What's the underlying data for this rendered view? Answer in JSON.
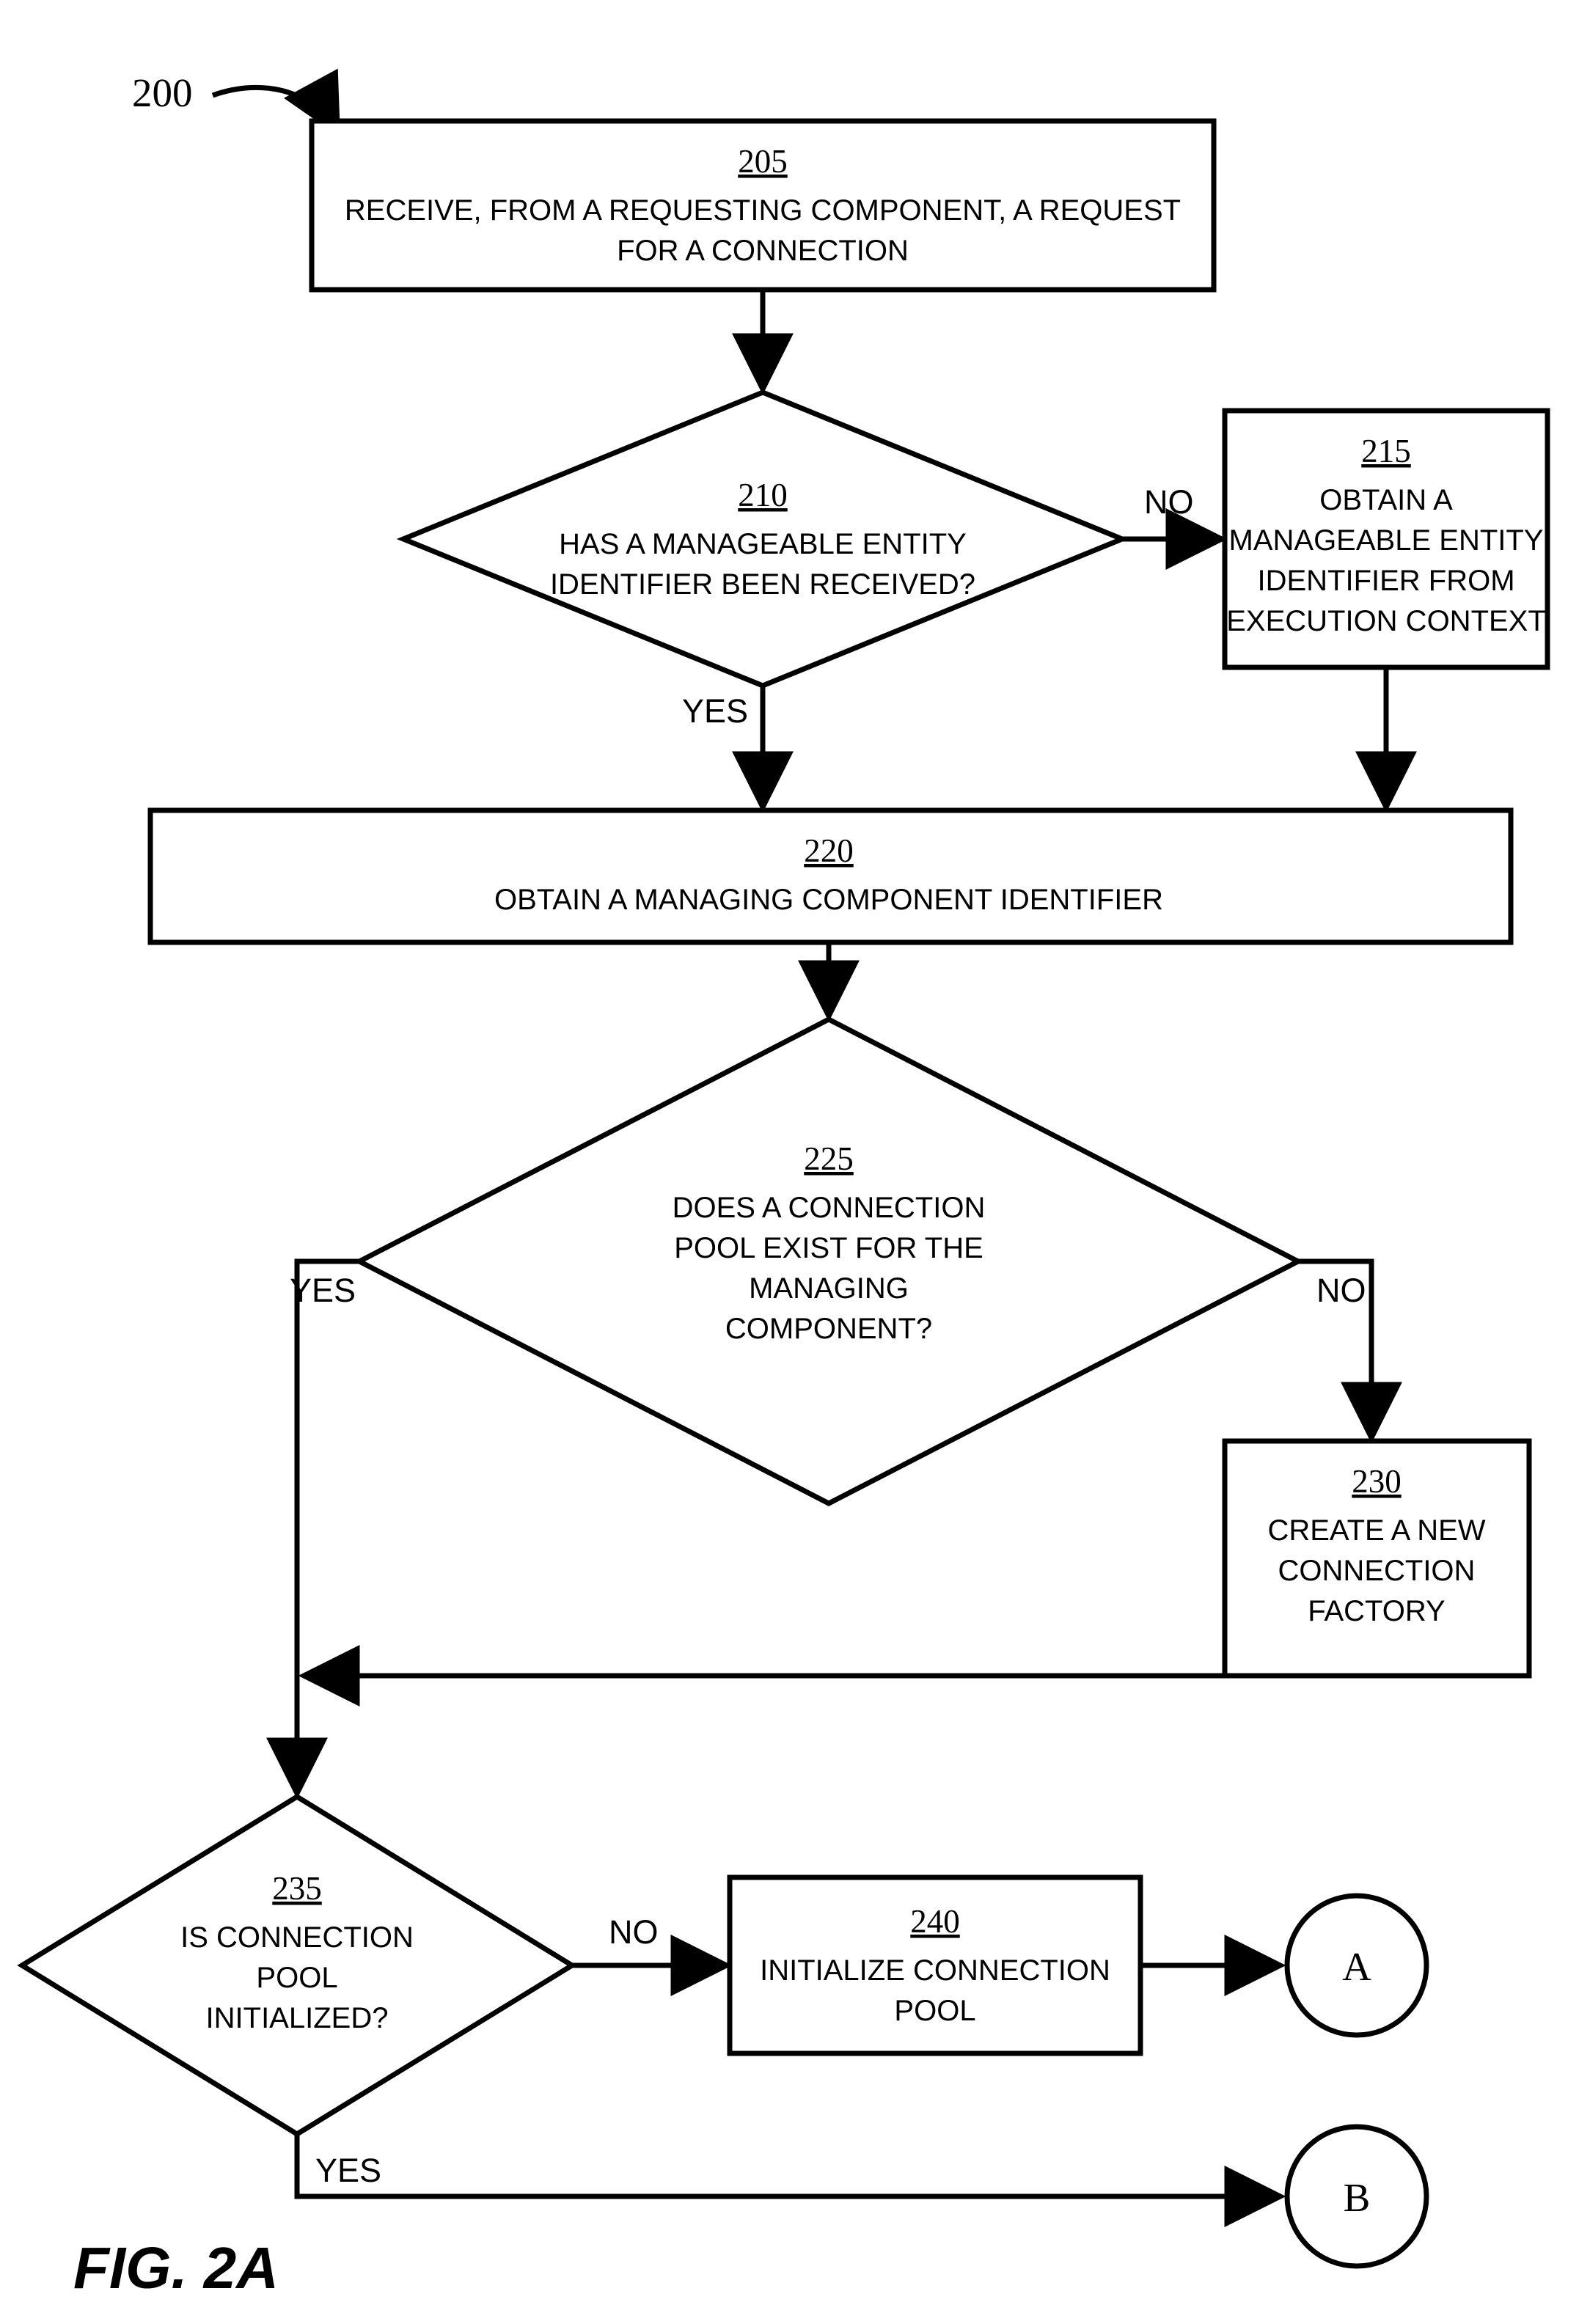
{
  "figure_ref": "200",
  "figure_label": "FIG. 2A",
  "nodes": {
    "n205": {
      "ref": "205",
      "l1": "RECEIVE, FROM A REQUESTING COMPONENT, A REQUEST",
      "l2": "FOR A CONNECTION"
    },
    "n210": {
      "ref": "210",
      "l1": "HAS A MANAGEABLE ENTITY",
      "l2": "IDENTIFIER BEEN RECEIVED?"
    },
    "n215": {
      "ref": "215",
      "l1": "OBTAIN A",
      "l2": "MANAGEABLE ENTITY",
      "l3": "IDENTIFIER FROM",
      "l4": "EXECUTION CONTEXT"
    },
    "n220": {
      "ref": "220",
      "l1": "OBTAIN A MANAGING COMPONENT IDENTIFIER"
    },
    "n225": {
      "ref": "225",
      "l1": "DOES A CONNECTION",
      "l2": "POOL EXIST FOR THE",
      "l3": "MANAGING",
      "l4": "COMPONENT?"
    },
    "n230": {
      "ref": "230",
      "l1": "CREATE A NEW",
      "l2": "CONNECTION",
      "l3": "FACTORY"
    },
    "n235": {
      "ref": "235",
      "l1": "IS CONNECTION",
      "l2": "POOL",
      "l3": "INITIALIZED?"
    },
    "n240": {
      "ref": "240",
      "l1": "INITIALIZE CONNECTION",
      "l2": "POOL"
    }
  },
  "edges": {
    "yes": "YES",
    "no": "NO"
  },
  "connectors": {
    "A": "A",
    "B": "B"
  }
}
